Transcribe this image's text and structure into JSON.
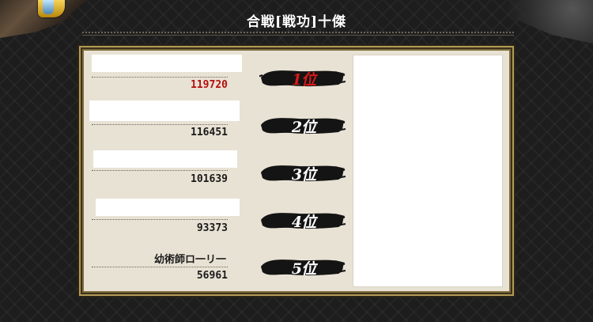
{
  "header": {
    "title": "合戦[戦功]十傑"
  },
  "colors": {
    "first_place_score": "#b40f0f",
    "first_place_rank": "#d61a1a",
    "panel_bg": "#e8e2d4",
    "frame_gold": "#b39a57"
  },
  "ranking": [
    {
      "rank_label": "1位",
      "name": "",
      "score": "119720"
    },
    {
      "rank_label": "2位",
      "name": "",
      "score": "116451"
    },
    {
      "rank_label": "3位",
      "name": "",
      "score": "101639"
    },
    {
      "rank_label": "4位",
      "name": "",
      "score": "93373"
    },
    {
      "rank_label": "5位",
      "name": "幼術師ロ一リ一",
      "score": "56961"
    }
  ]
}
